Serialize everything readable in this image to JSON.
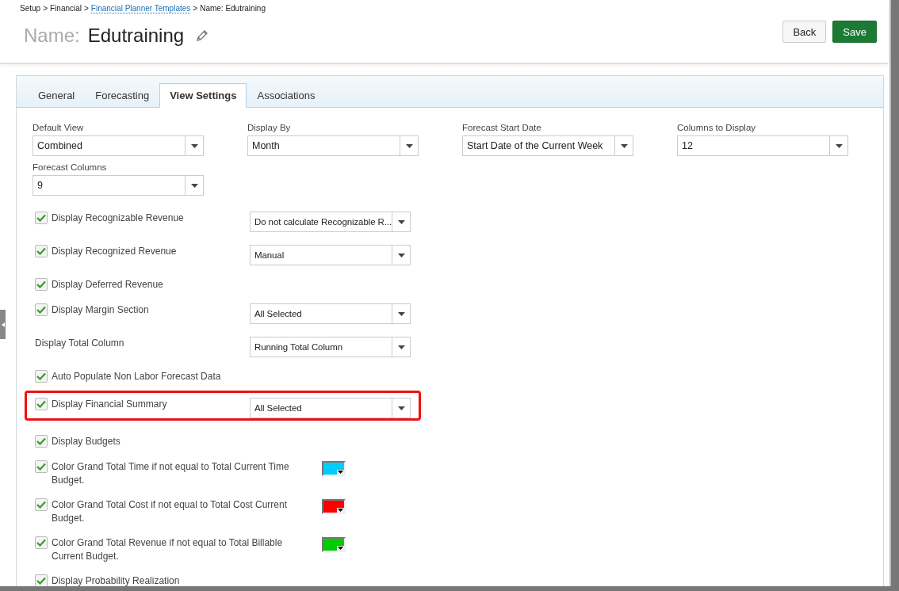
{
  "breadcrumb": [
    {
      "label": "Setup",
      "link": false
    },
    {
      "label": "Financial",
      "link": false
    },
    {
      "label": "Financial Planner Templates",
      "link": true
    },
    {
      "label": "Name: Edutraining",
      "link": false
    }
  ],
  "separator": ">",
  "title": {
    "prefix": "Name:",
    "name": "Edutraining"
  },
  "buttons": [
    {
      "label": "Back",
      "kind": "secondary"
    },
    {
      "label": "Save",
      "kind": "primary"
    }
  ],
  "tabs": [
    {
      "label": "General",
      "selected": false
    },
    {
      "label": "Forecasting",
      "selected": false
    },
    {
      "label": "View Settings",
      "selected": true
    },
    {
      "label": "Associations",
      "selected": false
    }
  ],
  "fields": [
    {
      "label": "Default View",
      "value": "Combined"
    },
    {
      "label": "Display By",
      "value": "Month"
    },
    {
      "label": "Forecast Start Date",
      "value": "Start Date of the Current Week"
    },
    {
      "label": "Columns to Display",
      "value": "12"
    },
    {
      "label": "Forecast Columns",
      "value": "9"
    }
  ],
  "settings": [
    {
      "kind": "checkbox",
      "label": "Display Recognizable Revenue",
      "checked": true,
      "select": "Do not calculate Recognizable R...",
      "highlighted": false
    },
    {
      "kind": "checkbox",
      "label": "Display Recognized Revenue",
      "checked": true,
      "select": "Manual",
      "highlighted": false
    },
    {
      "kind": "checkbox",
      "label": "Display Deferred Revenue",
      "checked": true,
      "highlighted": false
    },
    {
      "kind": "checkbox",
      "label": "Display Margin Section",
      "checked": true,
      "select": "All Selected",
      "highlighted": false
    },
    {
      "kind": "label",
      "label": "Display Total Column",
      "select": "Running Total Column",
      "highlighted": false
    },
    {
      "kind": "checkbox",
      "label": "Auto Populate Non Labor Forecast Data",
      "checked": true,
      "highlighted": false
    },
    {
      "kind": "checkbox",
      "label": "Display Financial Summary",
      "checked": true,
      "select": "All Selected",
      "highlighted": true
    },
    {
      "kind": "checkbox",
      "label": "Display Budgets",
      "checked": true,
      "highlighted": false
    },
    {
      "kind": "checkbox",
      "label": "Color Grand Total Time if not equal to Total Current Time Budget.",
      "checked": true,
      "color": "#00ccff",
      "highlighted": false
    },
    {
      "kind": "checkbox",
      "label": "Color Grand Total Cost if not equal to Total Cost Current Budget.",
      "checked": true,
      "color": "#ff0000",
      "highlighted": false
    },
    {
      "kind": "checkbox",
      "label": "Color Grand Total Revenue if not equal to Total Billable Current Budget.",
      "checked": true,
      "color": "#00cc00",
      "highlighted": false
    },
    {
      "kind": "checkbox",
      "label": "Display Probability Realization",
      "checked": true,
      "highlighted": false
    }
  ]
}
